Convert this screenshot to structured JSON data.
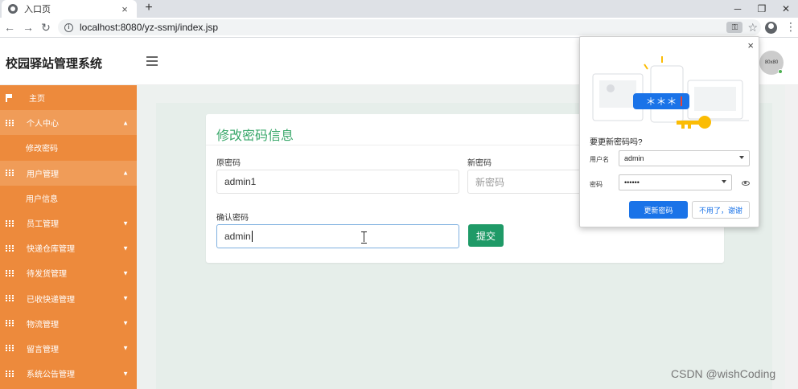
{
  "browser": {
    "tab_title": "入口页",
    "tab_close": "×",
    "new_tab": "+",
    "url": "localhost:8080/yz-ssmj/index.jsp",
    "window_controls": [
      "─",
      "❐",
      "✕"
    ],
    "nav": {
      "back": "←",
      "forward": "→",
      "reload": "↻"
    },
    "info_glyph": "i",
    "key_glyph": "⚿",
    "star_glyph": "☆",
    "menu_glyph": "⋮"
  },
  "header": {
    "brand": "校园驿站管理系统",
    "avatar_text": "80x80"
  },
  "sidebar": {
    "items": [
      {
        "label": "主页",
        "icon": "flag-icon",
        "kind": "home"
      },
      {
        "label": "个人中心",
        "icon": "grid-icon",
        "kind": "parent",
        "open": true,
        "caret": "▲"
      },
      {
        "label": "修改密码",
        "kind": "sub"
      },
      {
        "label": "用户管理",
        "icon": "grid-icon",
        "kind": "parent",
        "open": true,
        "caret": "▲"
      },
      {
        "label": "用户信息",
        "kind": "sub"
      },
      {
        "label": "员工管理",
        "icon": "grid-icon",
        "kind": "parent",
        "open": false,
        "caret": "▼"
      },
      {
        "label": "快递仓库管理",
        "icon": "grid-icon",
        "kind": "parent",
        "open": false,
        "caret": "▼"
      },
      {
        "label": "待发货管理",
        "icon": "grid-icon",
        "kind": "parent",
        "open": false,
        "caret": "▼"
      },
      {
        "label": "已收快递管理",
        "icon": "grid-icon",
        "kind": "parent",
        "open": false,
        "caret": "▼"
      },
      {
        "label": "物流管理",
        "icon": "grid-icon",
        "kind": "parent",
        "open": false,
        "caret": "▼"
      },
      {
        "label": "留言管理",
        "icon": "grid-icon",
        "kind": "parent",
        "open": false,
        "caret": "▼"
      },
      {
        "label": "系统公告管理",
        "icon": "grid-icon",
        "kind": "parent",
        "open": false,
        "caret": "▼"
      }
    ]
  },
  "form": {
    "title": "修改密码信息",
    "old_password": {
      "label": "原密码",
      "value": "admin1"
    },
    "new_password": {
      "label": "新密码",
      "placeholder": "新密码"
    },
    "confirm_password": {
      "label": "确认密码",
      "value": "admin"
    },
    "submit_label": "提交"
  },
  "popup": {
    "question": "要更新密码吗?",
    "username_label": "用户名",
    "username_value": "admin",
    "password_label": "密码",
    "password_value": "••••••",
    "update_label": "更新密码",
    "dismiss_label": "不用了，谢谢",
    "close_glyph": "×",
    "illustration_text": "＊＊＊"
  },
  "watermark": "CSDN @wishCoding",
  "colors": {
    "sidebar": "#ed8a3c",
    "sidebar_open": "#f09c58",
    "accent_green": "#3aa86b",
    "submit": "#1f9a67",
    "chrome_blue": "#1a73e8"
  }
}
